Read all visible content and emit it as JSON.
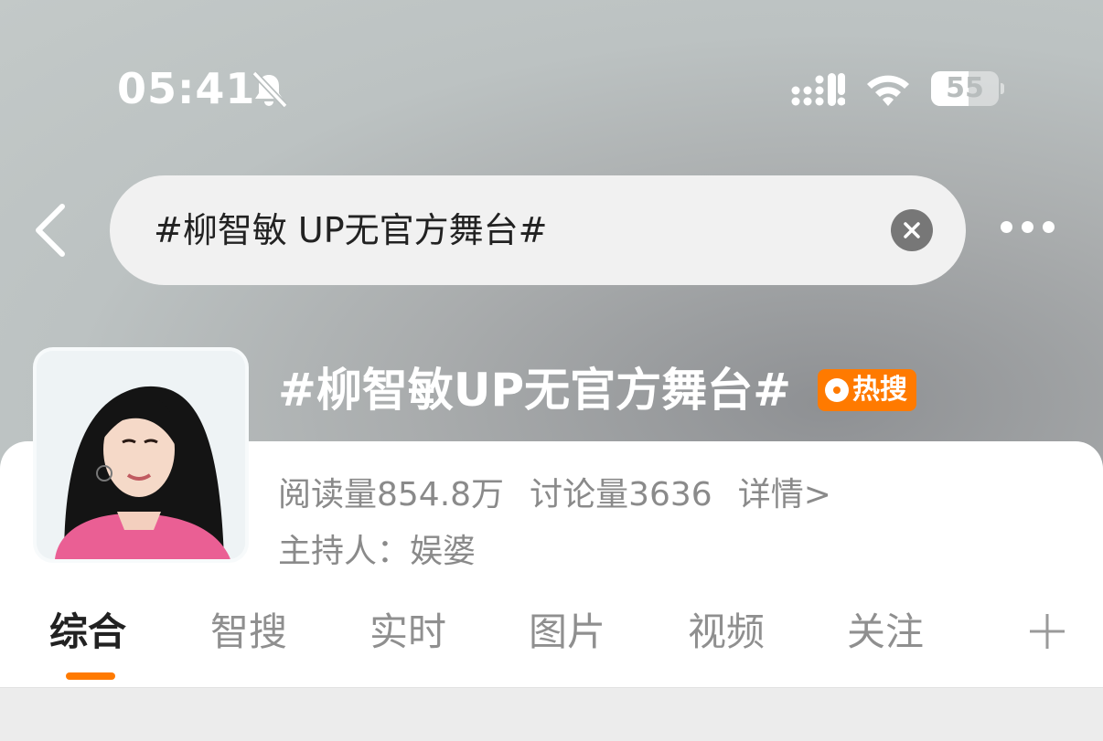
{
  "status_bar": {
    "time": "05:41",
    "battery": "55",
    "battery_level": 0.55,
    "icons": [
      "bell-off-icon",
      "signal-icon",
      "wifi-icon",
      "battery-icon"
    ]
  },
  "search": {
    "query": "#柳智敏 UP无官方舞台#",
    "back_icon": "chevron-left-icon",
    "clear_icon": "close-icon",
    "more_icon": "more-horizontal-icon"
  },
  "topic": {
    "title": "#柳智敏UP无官方舞台#",
    "badge": "热搜",
    "badge_color": "#ff7a00",
    "reads": "阅读量854.8万",
    "discussions": "讨论量3636",
    "details": "详情>",
    "host": "主持人：娱婆"
  },
  "tabs": [
    {
      "label": "综合",
      "active": true
    },
    {
      "label": "智搜",
      "active": false
    },
    {
      "label": "实时",
      "active": false
    },
    {
      "label": "图片",
      "active": false
    },
    {
      "label": "视频",
      "active": false
    },
    {
      "label": "关注",
      "active": false
    }
  ],
  "colors": {
    "accent": "#ff7a00",
    "text_primary": "#222222",
    "text_secondary": "#8a8a8a"
  }
}
